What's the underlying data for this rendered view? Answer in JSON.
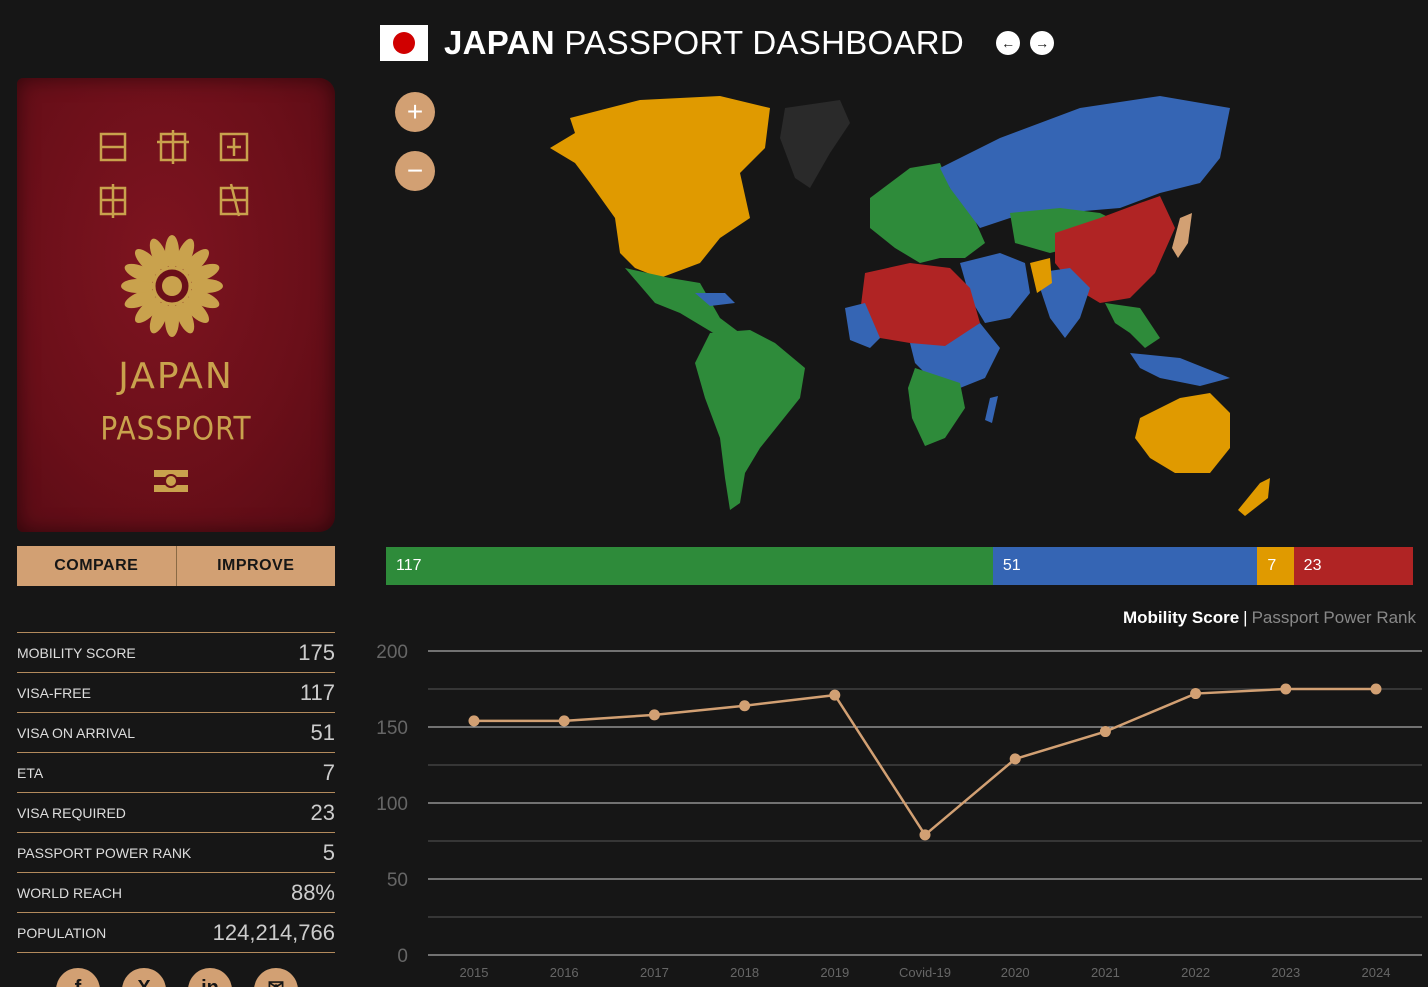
{
  "header": {
    "title_bold": "JAPAN",
    "title_rest": "PASSPORT DASHBOARD",
    "prev_icon": "arrow-left-icon",
    "next_icon": "arrow-right-icon"
  },
  "passport": {
    "title": "JAPAN",
    "subtitle": "PASSPORT",
    "kanji_top": "日本国",
    "kanji_bottom": "旅券"
  },
  "actions": {
    "compare": "COMPARE",
    "improve": "IMPROVE"
  },
  "stats": [
    {
      "label": "MOBILITY SCORE",
      "value": "175"
    },
    {
      "label": "VISA-FREE",
      "value": "117"
    },
    {
      "label": "VISA ON ARRIVAL",
      "value": "51"
    },
    {
      "label": "ETA",
      "value": "7"
    },
    {
      "label": "VISA REQUIRED",
      "value": "23"
    },
    {
      "label": "PASSPORT POWER RANK",
      "value": "5"
    },
    {
      "label": "WORLD REACH",
      "value": "88%"
    },
    {
      "label": "POPULATION",
      "value": "124,214,766"
    }
  ],
  "zoom": {
    "in": "+",
    "out": "−"
  },
  "distribution": [
    {
      "value": 117,
      "label": "117",
      "color": "#2e8b3a"
    },
    {
      "value": 51,
      "label": "51",
      "color": "#3565b4"
    },
    {
      "value": 7,
      "label": "7",
      "color": "#e09a00"
    },
    {
      "value": 23,
      "label": "23",
      "color": "#b02424"
    }
  ],
  "colors": {
    "visa_free": "#2e8b3a",
    "visa_on_arrival": "#3565b4",
    "eta": "#e09a00",
    "visa_required": "#b02424",
    "accent": "#d2a073"
  },
  "chart_legend": {
    "active": "Mobility Score",
    "separator": "|",
    "inactive": "Passport Power Rank"
  },
  "chart_data": {
    "type": "line",
    "categories": [
      "2015",
      "2016",
      "2017",
      "2018",
      "2019",
      "Covid-19",
      "2020",
      "2021",
      "2022",
      "2023",
      "2024"
    ],
    "values": [
      154,
      154,
      158,
      164,
      171,
      79,
      129,
      147,
      172,
      175,
      175
    ],
    "ylim": [
      0,
      200
    ],
    "yticks": [
      0,
      50,
      100,
      150,
      200
    ],
    "grid": true,
    "color": "#d2a073"
  }
}
